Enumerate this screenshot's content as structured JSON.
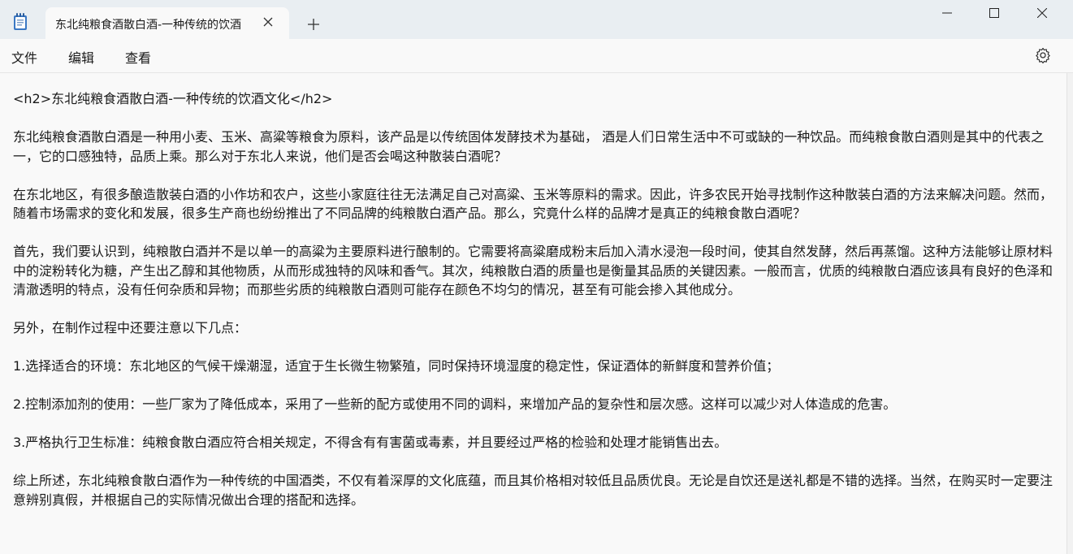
{
  "window": {
    "tab_title": "东北纯粮食酒散白酒-一种传统的饮酒",
    "icons": {
      "app": "notepad-icon",
      "close_tab": "close-icon",
      "new_tab": "plus-icon",
      "minimize": "minimize-icon",
      "maximize": "maximize-icon",
      "close": "close-icon",
      "settings": "gear-icon"
    }
  },
  "menu": {
    "file": "文件",
    "edit": "编辑",
    "view": "查看"
  },
  "document": {
    "lines": [
      "<h2>东北纯粮食酒散白酒-一种传统的饮酒文化</h2>",
      "东北纯粮食酒散白酒是一种用小麦、玉米、高粱等粮食为原料，该产品是以传统固体发酵技术为基础， 酒是人们日常生活中不可或缺的一种饮品。而纯粮食散白酒则是其中的代表之一，它的口感独特，品质上乘。那么对于东北人来说，他们是否会喝这种散装白酒呢？",
      "在东北地区，有很多酿造散装白酒的小作坊和农户，这些小家庭往往无法满足自己对高粱、玉米等原料的需求。因此，许多农民开始寻找制作这种散装白酒的方法来解决问题。然而，随着市场需求的变化和发展，很多生产商也纷纷推出了不同品牌的纯粮散白酒产品。那么，究竟什么样的品牌才是真正的纯粮食散白酒呢？",
      "首先，我们要认识到，纯粮散白酒并不是以单一的高粱为主要原料进行酿制的。它需要将高粱磨成粉末后加入清水浸泡一段时间，使其自然发酵，然后再蒸馏。这种方法能够让原材料中的淀粉转化为糖，产生出乙醇和其他物质，从而形成独特的风味和香气。其次，纯粮散白酒的质量也是衡量其品质的关键因素。一般而言，优质的纯粮散白酒应该具有良好的色泽和清澈透明的特点，没有任何杂质和异物；而那些劣质的纯粮散白酒则可能存在颜色不均匀的情况，甚至有可能会掺入其他成分。",
      "另外，在制作过程中还要注意以下几点：",
      "1.选择适合的环境：东北地区的气候干燥潮湿，适宜于生长微生物繁殖，同时保持环境湿度的稳定性，保证酒体的新鲜度和营养价值；",
      "2.控制添加剂的使用：一些厂家为了降低成本，采用了一些新的配方或使用不同的调料，来增加产品的复杂性和层次感。这样可以减少对人体造成的危害。",
      "3.严格执行卫生标准：纯粮食散白酒应符合相关规定，不得含有有害菌或毒素，并且要经过严格的检验和处理才能销售出去。",
      "综上所述，东北纯粮食散白酒作为一种传统的中国酒类，不仅有着深厚的文化底蕴，而且其价格相对较低且品质优良。无论是自饮还是送礼都是不错的选择。当然，在购买时一定要注意辨别真假，并根据自己的实际情况做出合理的搭配和选择。"
    ]
  }
}
